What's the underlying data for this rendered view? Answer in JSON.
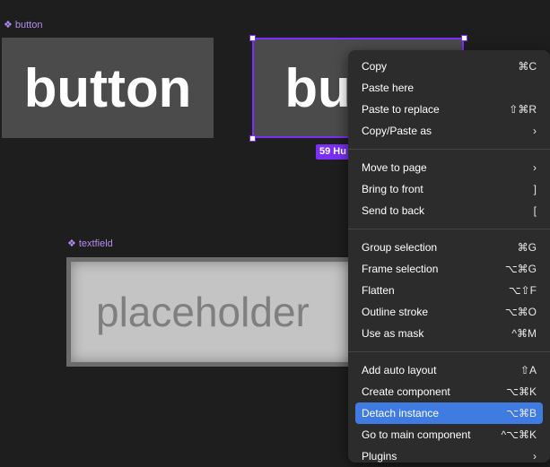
{
  "canvas": {
    "button_label": "button",
    "button_text": "button",
    "instance_text": "but",
    "size_badge": "59 Hu",
    "textfield_label": "textfield",
    "textfield_placeholder": "placeholder",
    "component_glyph": "❖",
    "selection_color": "#7b2ff7"
  },
  "context_menu": {
    "highlight_color": "#3f7be0",
    "groups": [
      [
        {
          "label": "Copy",
          "shortcut": "⌘C"
        },
        {
          "label": "Paste here",
          "shortcut": ""
        },
        {
          "label": "Paste to replace",
          "shortcut": "⇧⌘R"
        },
        {
          "label": "Copy/Paste as",
          "shortcut": "›"
        }
      ],
      [
        {
          "label": "Move to page",
          "shortcut": "›"
        },
        {
          "label": "Bring to front",
          "shortcut": "]"
        },
        {
          "label": "Send to back",
          "shortcut": "["
        }
      ],
      [
        {
          "label": "Group selection",
          "shortcut": "⌘G"
        },
        {
          "label": "Frame selection",
          "shortcut": "⌥⌘G"
        },
        {
          "label": "Flatten",
          "shortcut": "⌥⇧F"
        },
        {
          "label": "Outline stroke",
          "shortcut": "⌥⌘O"
        },
        {
          "label": "Use as mask",
          "shortcut": "^⌘M"
        }
      ],
      [
        {
          "label": "Add auto layout",
          "shortcut": "⇧A"
        },
        {
          "label": "Create component",
          "shortcut": "⌥⌘K"
        },
        {
          "label": "Detach instance",
          "shortcut": "⌥⌘B",
          "active": true
        },
        {
          "label": "Go to main component",
          "shortcut": "^⌥⌘K"
        },
        {
          "label": "Plugins",
          "shortcut": "›"
        }
      ]
    ]
  }
}
